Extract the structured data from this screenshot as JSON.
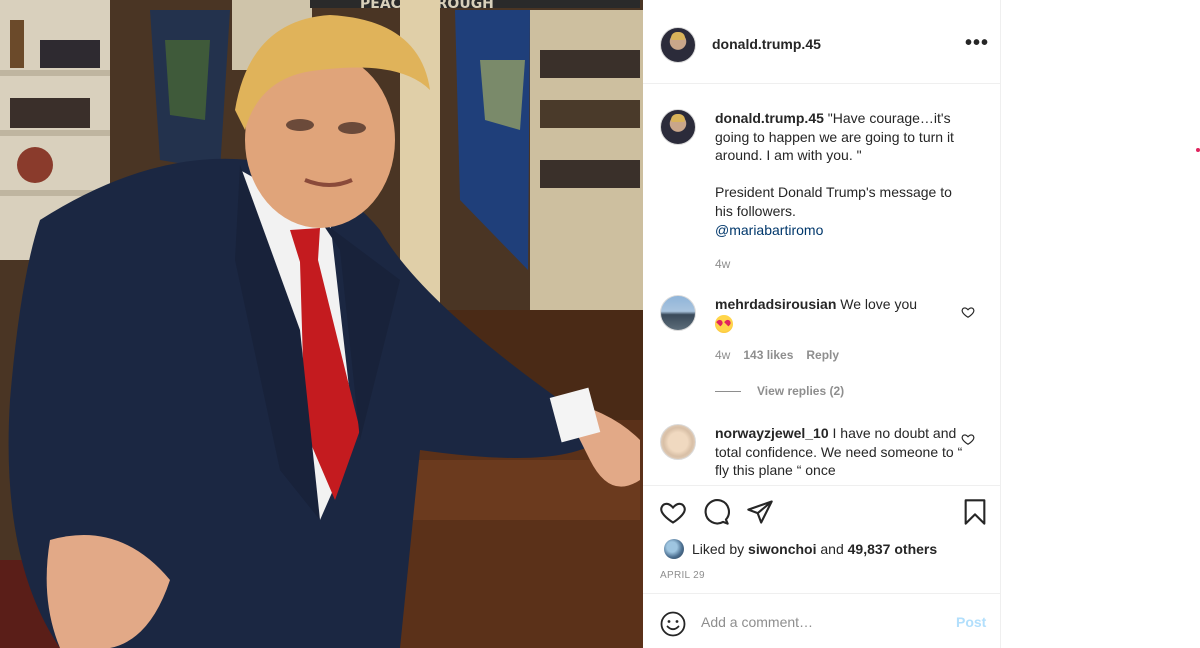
{
  "post": {
    "username": "donald.trump.45",
    "more_icon": "ellipsis-icon",
    "photo_banner": "PEACE THROUGH"
  },
  "caption": {
    "username": "donald.trump.45",
    "line1": "\"Have courage…it's going to happen we are going to turn it around. I am with you. \"",
    "line2": "President Donald Trump's message to his followers.",
    "mention": "@mariabartiromo",
    "time": "4w"
  },
  "comments": [
    {
      "username": "mehrdadsirousian",
      "text": "We love you",
      "emoji": "heart-eyes-emoji",
      "time": "4w",
      "likes": "143 likes",
      "reply": "Reply",
      "view_replies": "View replies (2)"
    },
    {
      "username": "norwayzjewel_10",
      "text": "I have no doubt and total confidence. We need someone to “ fly this plane “ once"
    }
  ],
  "actions": {
    "liked_by_prefix": "Liked by",
    "liked_by_user": "siwonchoi",
    "liked_by_and": "and",
    "liked_by_others": "49,837 others",
    "date": "APRIL 29"
  },
  "comment_box": {
    "placeholder": "Add a comment…",
    "post_label": "Post"
  }
}
